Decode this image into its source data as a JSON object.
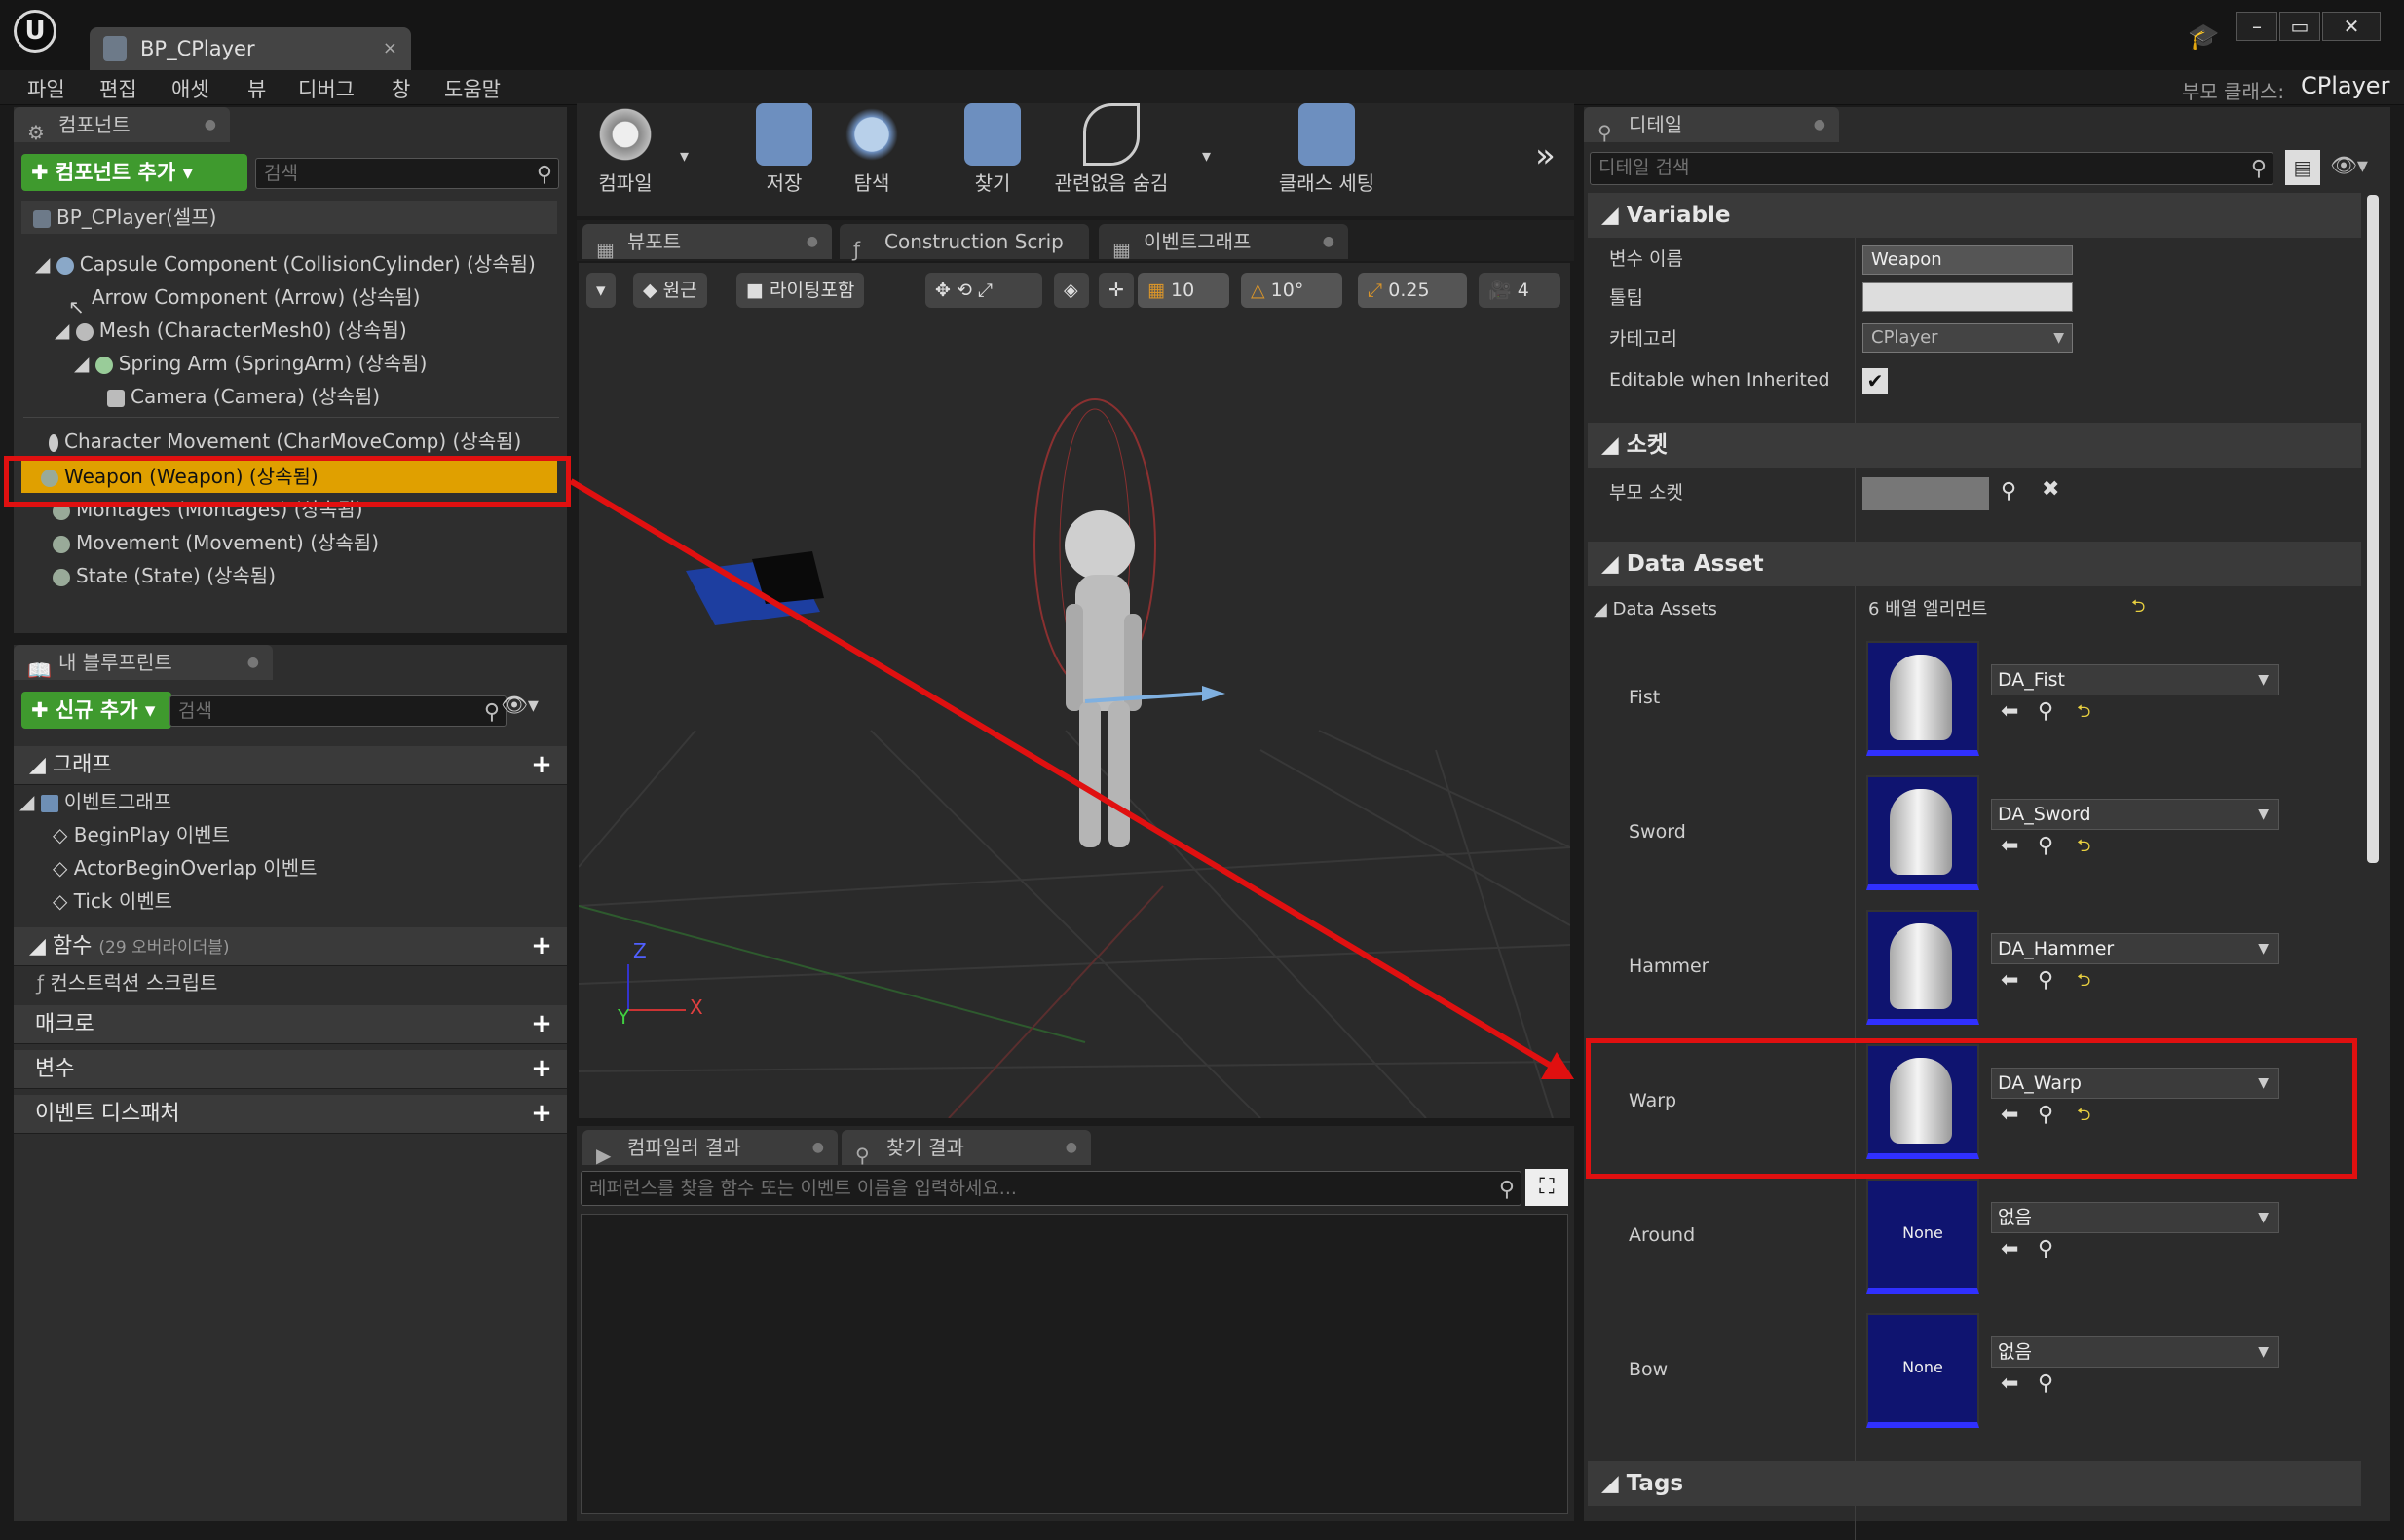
{
  "window": {
    "tab_title": "BP_CPlayer",
    "logo": "U"
  },
  "menu": [
    "파일",
    "편집",
    "애셋",
    "뷰",
    "디버그",
    "창",
    "도움말"
  ],
  "parent_class": {
    "label": "부모 클래스:",
    "value": "CPlayer"
  },
  "components_panel": {
    "tab": "컴포넌트",
    "add_button": "컴포넌트 추가",
    "search_placeholder": "검색",
    "root": "BP_CPlayer(셀프)",
    "items": [
      "Capsule Component (CollisionCylinder) (상속됨)",
      "Arrow Component (Arrow) (상속됨)",
      "Mesh (CharacterMesh0) (상속됨)",
      "Spring Arm (SpringArm) (상속됨)",
      "Camera (Camera) (상속됨)",
      "Character Movement (CharMoveComp) (상속됨)",
      "Weapon (Weapon) (상속됨)",
      "Montages (Montages) (상속됨)",
      "Movement (Movement) (상속됨)",
      "State (State) (상속됨)"
    ]
  },
  "blueprint_panel": {
    "tab": "내 블루프린트",
    "add_button": "신규 추가",
    "search_placeholder": "검색",
    "graph_label": "그래프",
    "event_graph": "이벤트그래프",
    "events": [
      "BeginPlay 이벤트",
      "ActorBeginOverlap 이벤트",
      "Tick 이벤트"
    ],
    "functions_label": "함수",
    "functions_note": "(29 오버라이더블)",
    "construction_script": "컨스트럭션 스크립트",
    "macros_label": "매크로",
    "variables_label": "변수",
    "dispatchers_label": "이벤트 디스패처"
  },
  "toolbar": {
    "compile": "컴파일",
    "save": "저장",
    "browse": "탐색",
    "find": "찾기",
    "hide_unrelated": "관련없음 숨김",
    "class_settings": "클래스 세팅"
  },
  "editor_tabs": [
    "뷰포트",
    "Construction Scrip",
    "이벤트그래프"
  ],
  "viewport_toolbar": {
    "perspective": "원근",
    "lit": "라이팅포함",
    "grid_snap": "10",
    "rot_snap": "10°",
    "scale_snap": "0.25",
    "camera_speed": "4"
  },
  "axis": {
    "x": "X",
    "y": "Y",
    "z": "Z"
  },
  "bottom_tabs": [
    "컴파일러 결과",
    "찾기 결과"
  ],
  "find_placeholder": "레퍼런스를 찾을 함수 또는 이벤트 이름을 입력하세요...",
  "details": {
    "tab": "디테일",
    "search_placeholder": "디테일 검색",
    "variable_section": "Variable",
    "var_name_label": "변수 이름",
    "var_name_value": "Weapon",
    "tooltip_label": "툴팁",
    "category_label": "카테고리",
    "category_value": "CPlayer",
    "editable_label": "Editable when Inherited",
    "socket_section": "소켓",
    "parent_socket_label": "부모 소켓",
    "data_asset_section": "Data Asset",
    "data_assets_label": "Data Assets",
    "data_assets_count": "6 배열 엘리먼트",
    "assets": [
      {
        "name": "Fist",
        "value": "DA_Fist",
        "thumb": "cylinder"
      },
      {
        "name": "Sword",
        "value": "DA_Sword",
        "thumb": "cylinder"
      },
      {
        "name": "Hammer",
        "value": "DA_Hammer",
        "thumb": "cylinder"
      },
      {
        "name": "Warp",
        "value": "DA_Warp",
        "thumb": "cylinder"
      },
      {
        "name": "Around",
        "value": "없음",
        "thumb": "None"
      },
      {
        "name": "Bow",
        "value": "없음",
        "thumb": "None"
      }
    ],
    "tags_section": "Tags"
  },
  "colors": {
    "highlight": "#e0a000",
    "annotation": "#e01010",
    "add_green": "#3f9a2e"
  }
}
